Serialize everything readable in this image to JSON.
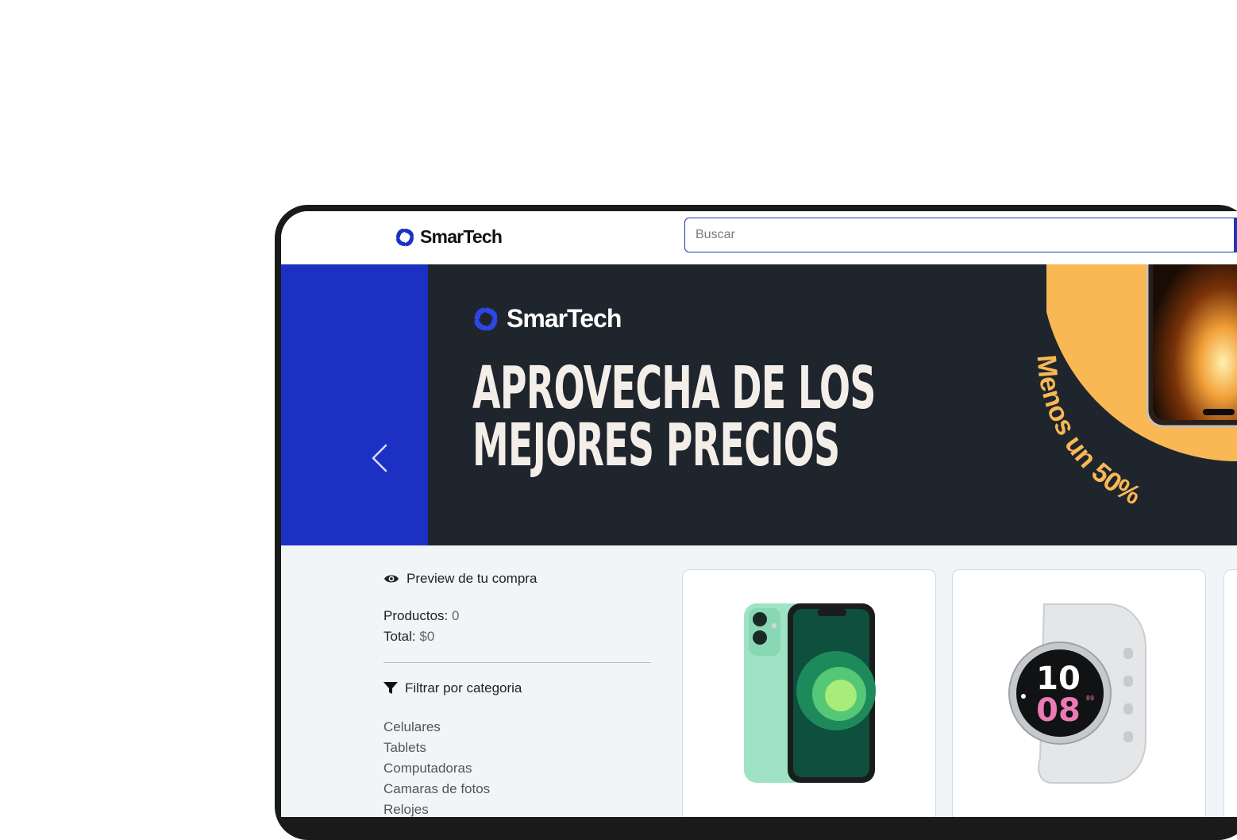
{
  "brand": {
    "name": "SmarTech"
  },
  "search": {
    "placeholder": "Buscar"
  },
  "banner": {
    "logo_text": "SmarTech",
    "headline_line1": "APROVECHA DE LOS",
    "headline_line2": "MEJORES PRECIOS",
    "promo_text": "Menos un 50%",
    "colors": {
      "blue_panel": "#1c31c4",
      "dark_bg": "#1f252d",
      "accent": "#f9b854"
    }
  },
  "sidebar": {
    "preview_title": "Preview de tu compra",
    "products_label": "Productos:",
    "products_value": "0",
    "total_label": "Total:",
    "total_value": "$0",
    "filter_title": "Filtrar por categoria",
    "categories": [
      "Celulares",
      "Tablets",
      "Computadoras",
      "Camaras de fotos",
      "Relojes"
    ]
  },
  "watch_face": {
    "hour": "10",
    "minute": "08",
    "small": "89"
  },
  "products": [
    {
      "image": "green-smartphone-image"
    },
    {
      "image": "smartwatch-image"
    },
    {
      "image": "product-image"
    }
  ]
}
